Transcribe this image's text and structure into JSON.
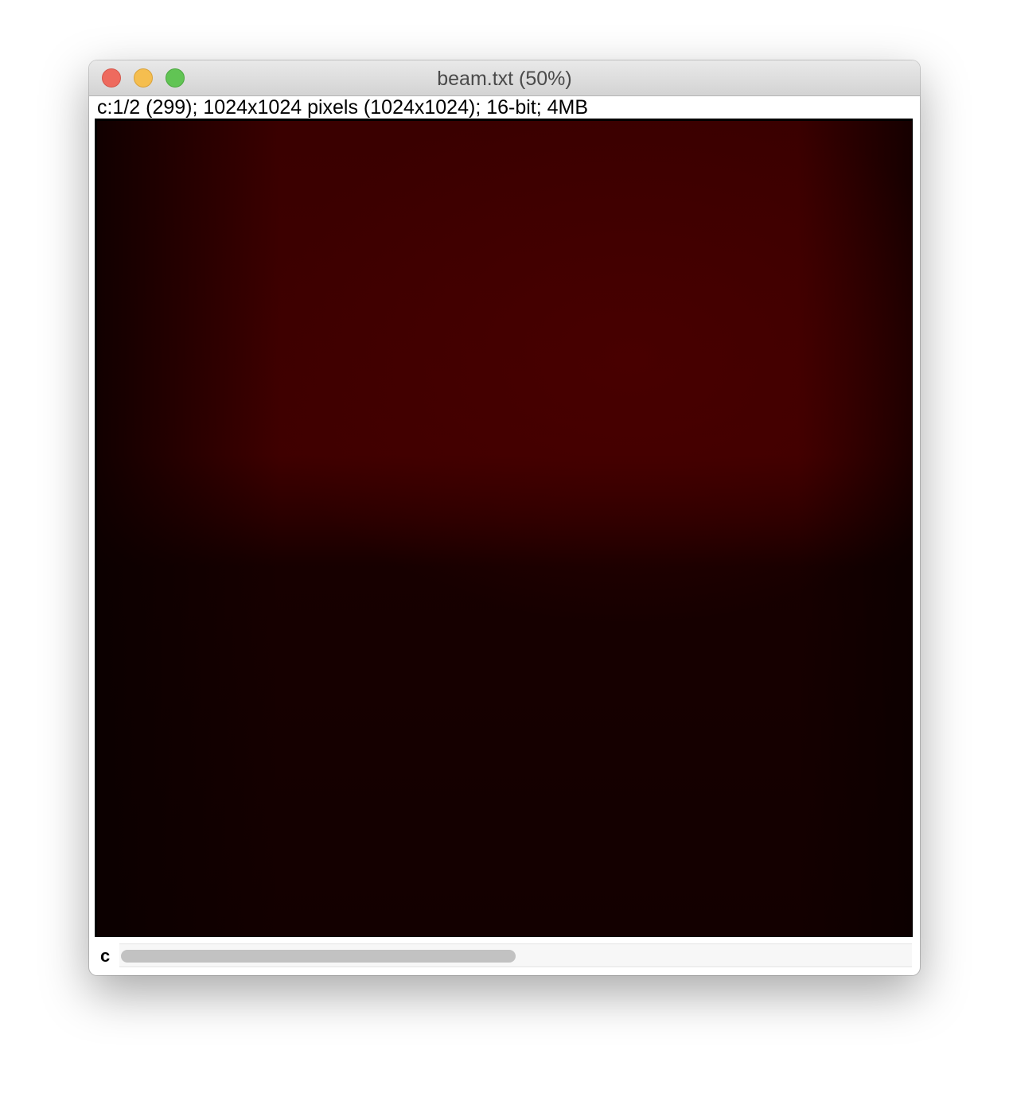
{
  "window": {
    "title": "beam.txt (50%)"
  },
  "image_info": {
    "text": "c:1/2 (299); 1024x1024 pixels (1024x1024); 16-bit; 4MB"
  },
  "channel_slider": {
    "label": "c",
    "position_fraction": 0.5
  },
  "colors": {
    "image_lut": "#3f0000"
  }
}
